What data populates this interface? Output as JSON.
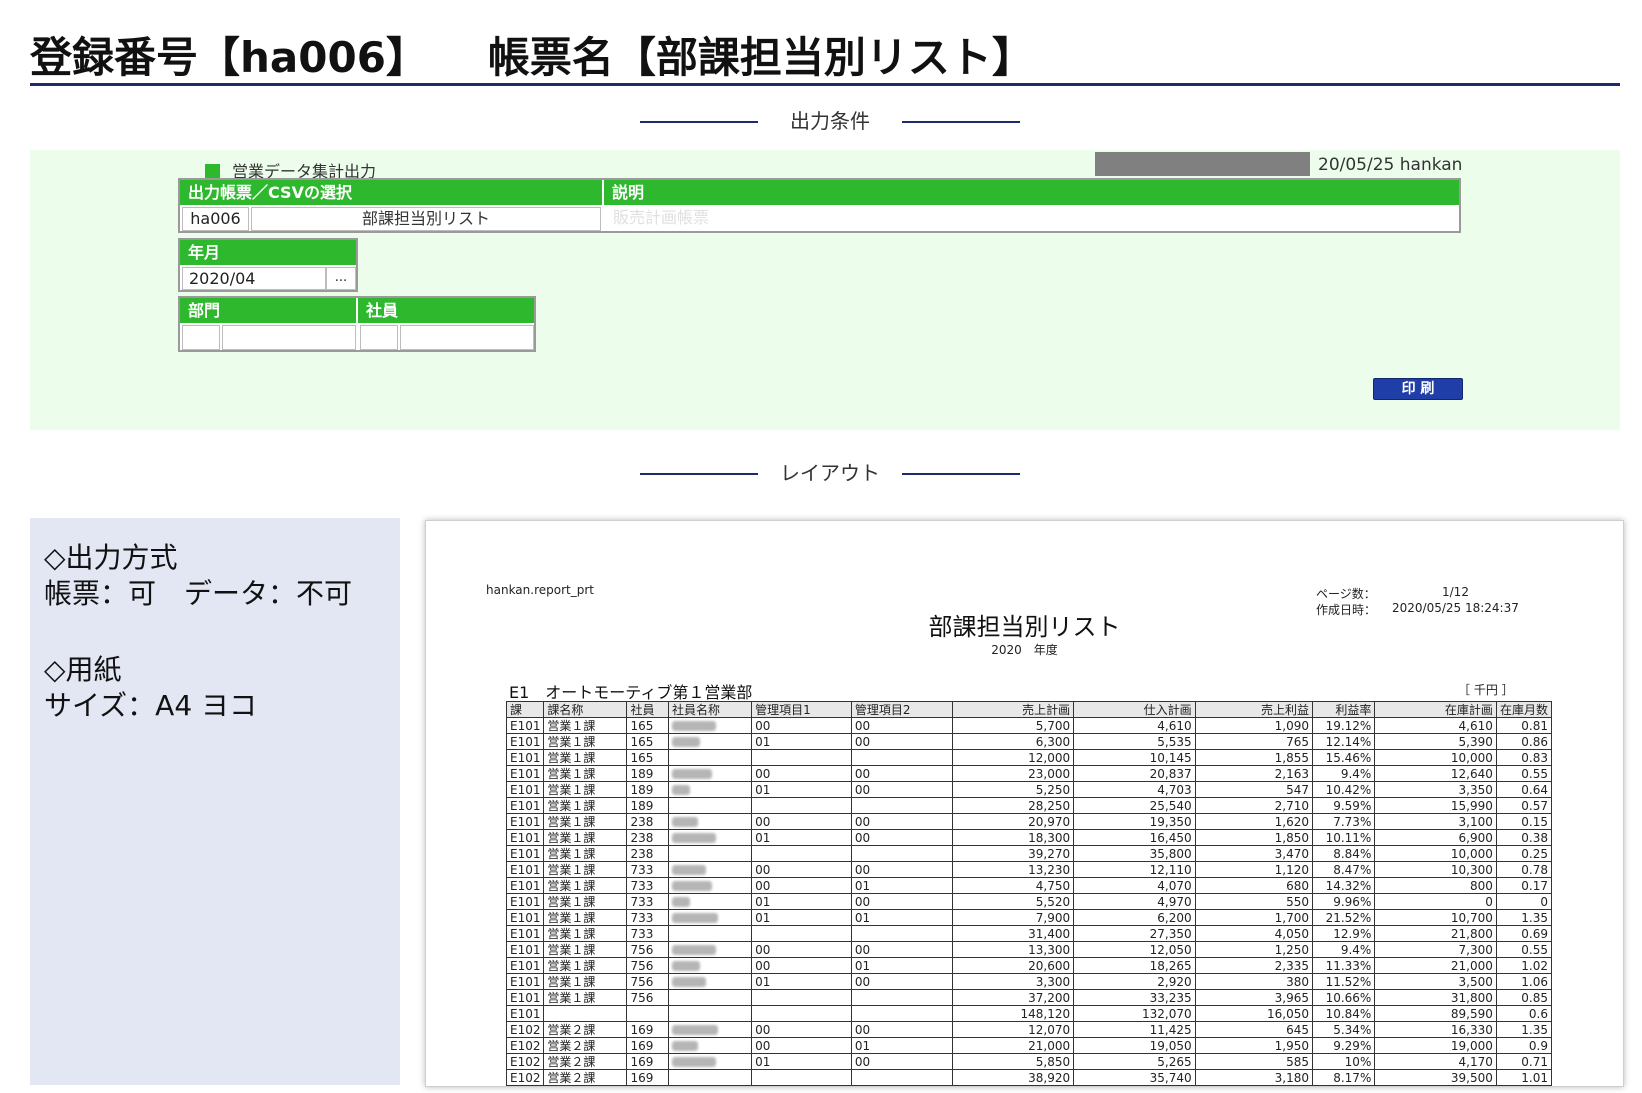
{
  "header": {
    "registration": "登録番号【ha006】",
    "form_name": "帳票名【部課担当別リスト】"
  },
  "sections": {
    "conditions": "出力条件",
    "layout": "レイアウト"
  },
  "app": {
    "title": "営業データ集計出力",
    "user_info": "20/05/25 hankan",
    "print_button": "印 刷",
    "output_select": {
      "header": "出力帳票／CSVの選択",
      "code": "ha006",
      "name": "部課担当別リスト"
    },
    "description": {
      "header": "説明",
      "value": "販売計画帳票"
    },
    "year_month": {
      "header": "年月",
      "value": "2020/04",
      "picker": "..."
    },
    "department_label": "部門",
    "employee_label": "社員"
  },
  "spec": {
    "output_method_heading": "◇出力方式",
    "output_method_value": "帳票：可　データ：不可",
    "paper_heading": "◇用紙",
    "paper_value": "サイズ：A4 ヨコ"
  },
  "report": {
    "program": "hankan.report_prt",
    "page_label": "ページ数：",
    "page_value": "1/12",
    "created_label": "作成日時：",
    "created_value": "2020/05/25 18:24:37",
    "title": "部課担当別リスト",
    "year": "2020　年度",
    "department": "E1　オートモーティブ第１営業部",
    "unit": "［ 千円 ］",
    "columns": [
      "課",
      "課名称",
      "社員",
      "社員名称",
      "管理項目1",
      "管理項目2",
      "売上計画",
      "仕入計画",
      "売上利益",
      "利益率",
      "在庫計画",
      "在庫月数"
    ],
    "rows": [
      [
        "E101",
        "営業１課",
        "165",
        "",
        "00",
        "00",
        "5,700",
        "4,610",
        "1,090",
        "19.12%",
        "4,610",
        "0.81"
      ],
      [
        "E101",
        "営業１課",
        "165",
        "",
        "01",
        "00",
        "6,300",
        "5,535",
        "765",
        "12.14%",
        "5,390",
        "0.86"
      ],
      [
        "E101",
        "営業１課",
        "165",
        "",
        "",
        "",
        "12,000",
        "10,145",
        "1,855",
        "15.46%",
        "10,000",
        "0.83"
      ],
      [
        "E101",
        "営業１課",
        "189",
        "",
        "00",
        "00",
        "23,000",
        "20,837",
        "2,163",
        "9.4%",
        "12,640",
        "0.55"
      ],
      [
        "E101",
        "営業１課",
        "189",
        "",
        "01",
        "00",
        "5,250",
        "4,703",
        "547",
        "10.42%",
        "3,350",
        "0.64"
      ],
      [
        "E101",
        "営業１課",
        "189",
        "",
        "",
        "",
        "28,250",
        "25,540",
        "2,710",
        "9.59%",
        "15,990",
        "0.57"
      ],
      [
        "E101",
        "営業１課",
        "238",
        "",
        "00",
        "00",
        "20,970",
        "19,350",
        "1,620",
        "7.73%",
        "3,100",
        "0.15"
      ],
      [
        "E101",
        "営業１課",
        "238",
        "",
        "01",
        "00",
        "18,300",
        "16,450",
        "1,850",
        "10.11%",
        "6,900",
        "0.38"
      ],
      [
        "E101",
        "営業１課",
        "238",
        "",
        "",
        "",
        "39,270",
        "35,800",
        "3,470",
        "8.84%",
        "10,000",
        "0.25"
      ],
      [
        "E101",
        "営業１課",
        "733",
        "",
        "00",
        "00",
        "13,230",
        "12,110",
        "1,120",
        "8.47%",
        "10,300",
        "0.78"
      ],
      [
        "E101",
        "営業１課",
        "733",
        "",
        "00",
        "01",
        "4,750",
        "4,070",
        "680",
        "14.32%",
        "800",
        "0.17"
      ],
      [
        "E101",
        "営業１課",
        "733",
        "",
        "01",
        "00",
        "5,520",
        "4,970",
        "550",
        "9.96%",
        "0",
        "0"
      ],
      [
        "E101",
        "営業１課",
        "733",
        "",
        "01",
        "01",
        "7,900",
        "6,200",
        "1,700",
        "21.52%",
        "10,700",
        "1.35"
      ],
      [
        "E101",
        "営業１課",
        "733",
        "",
        "",
        "",
        "31,400",
        "27,350",
        "4,050",
        "12.9%",
        "21,800",
        "0.69"
      ],
      [
        "E101",
        "営業１課",
        "756",
        "",
        "00",
        "00",
        "13,300",
        "12,050",
        "1,250",
        "9.4%",
        "7,300",
        "0.55"
      ],
      [
        "E101",
        "営業１課",
        "756",
        "",
        "00",
        "01",
        "20,600",
        "18,265",
        "2,335",
        "11.33%",
        "21,000",
        "1.02"
      ],
      [
        "E101",
        "営業１課",
        "756",
        "",
        "01",
        "00",
        "3,300",
        "2,920",
        "380",
        "11.52%",
        "3,500",
        "1.06"
      ],
      [
        "E101",
        "営業１課",
        "756",
        "",
        "",
        "",
        "37,200",
        "33,235",
        "3,965",
        "10.66%",
        "31,800",
        "0.85"
      ],
      [
        "E101",
        "",
        "",
        "",
        "",
        "",
        "148,120",
        "132,070",
        "16,050",
        "10.84%",
        "89,590",
        "0.6"
      ],
      [
        "E102",
        "営業２課",
        "169",
        "",
        "00",
        "00",
        "12,070",
        "11,425",
        "645",
        "5.34%",
        "16,330",
        "1.35"
      ],
      [
        "E102",
        "営業２課",
        "169",
        "",
        "00",
        "01",
        "21,000",
        "19,050",
        "1,950",
        "9.29%",
        "19,000",
        "0.9"
      ],
      [
        "E102",
        "営業２課",
        "169",
        "",
        "01",
        "00",
        "5,850",
        "5,265",
        "585",
        "10%",
        "4,170",
        "0.71"
      ],
      [
        "E102",
        "営業２課",
        "169",
        "",
        "",
        "",
        "38,920",
        "35,740",
        "3,180",
        "8.17%",
        "39,500",
        "1.01"
      ]
    ]
  }
}
